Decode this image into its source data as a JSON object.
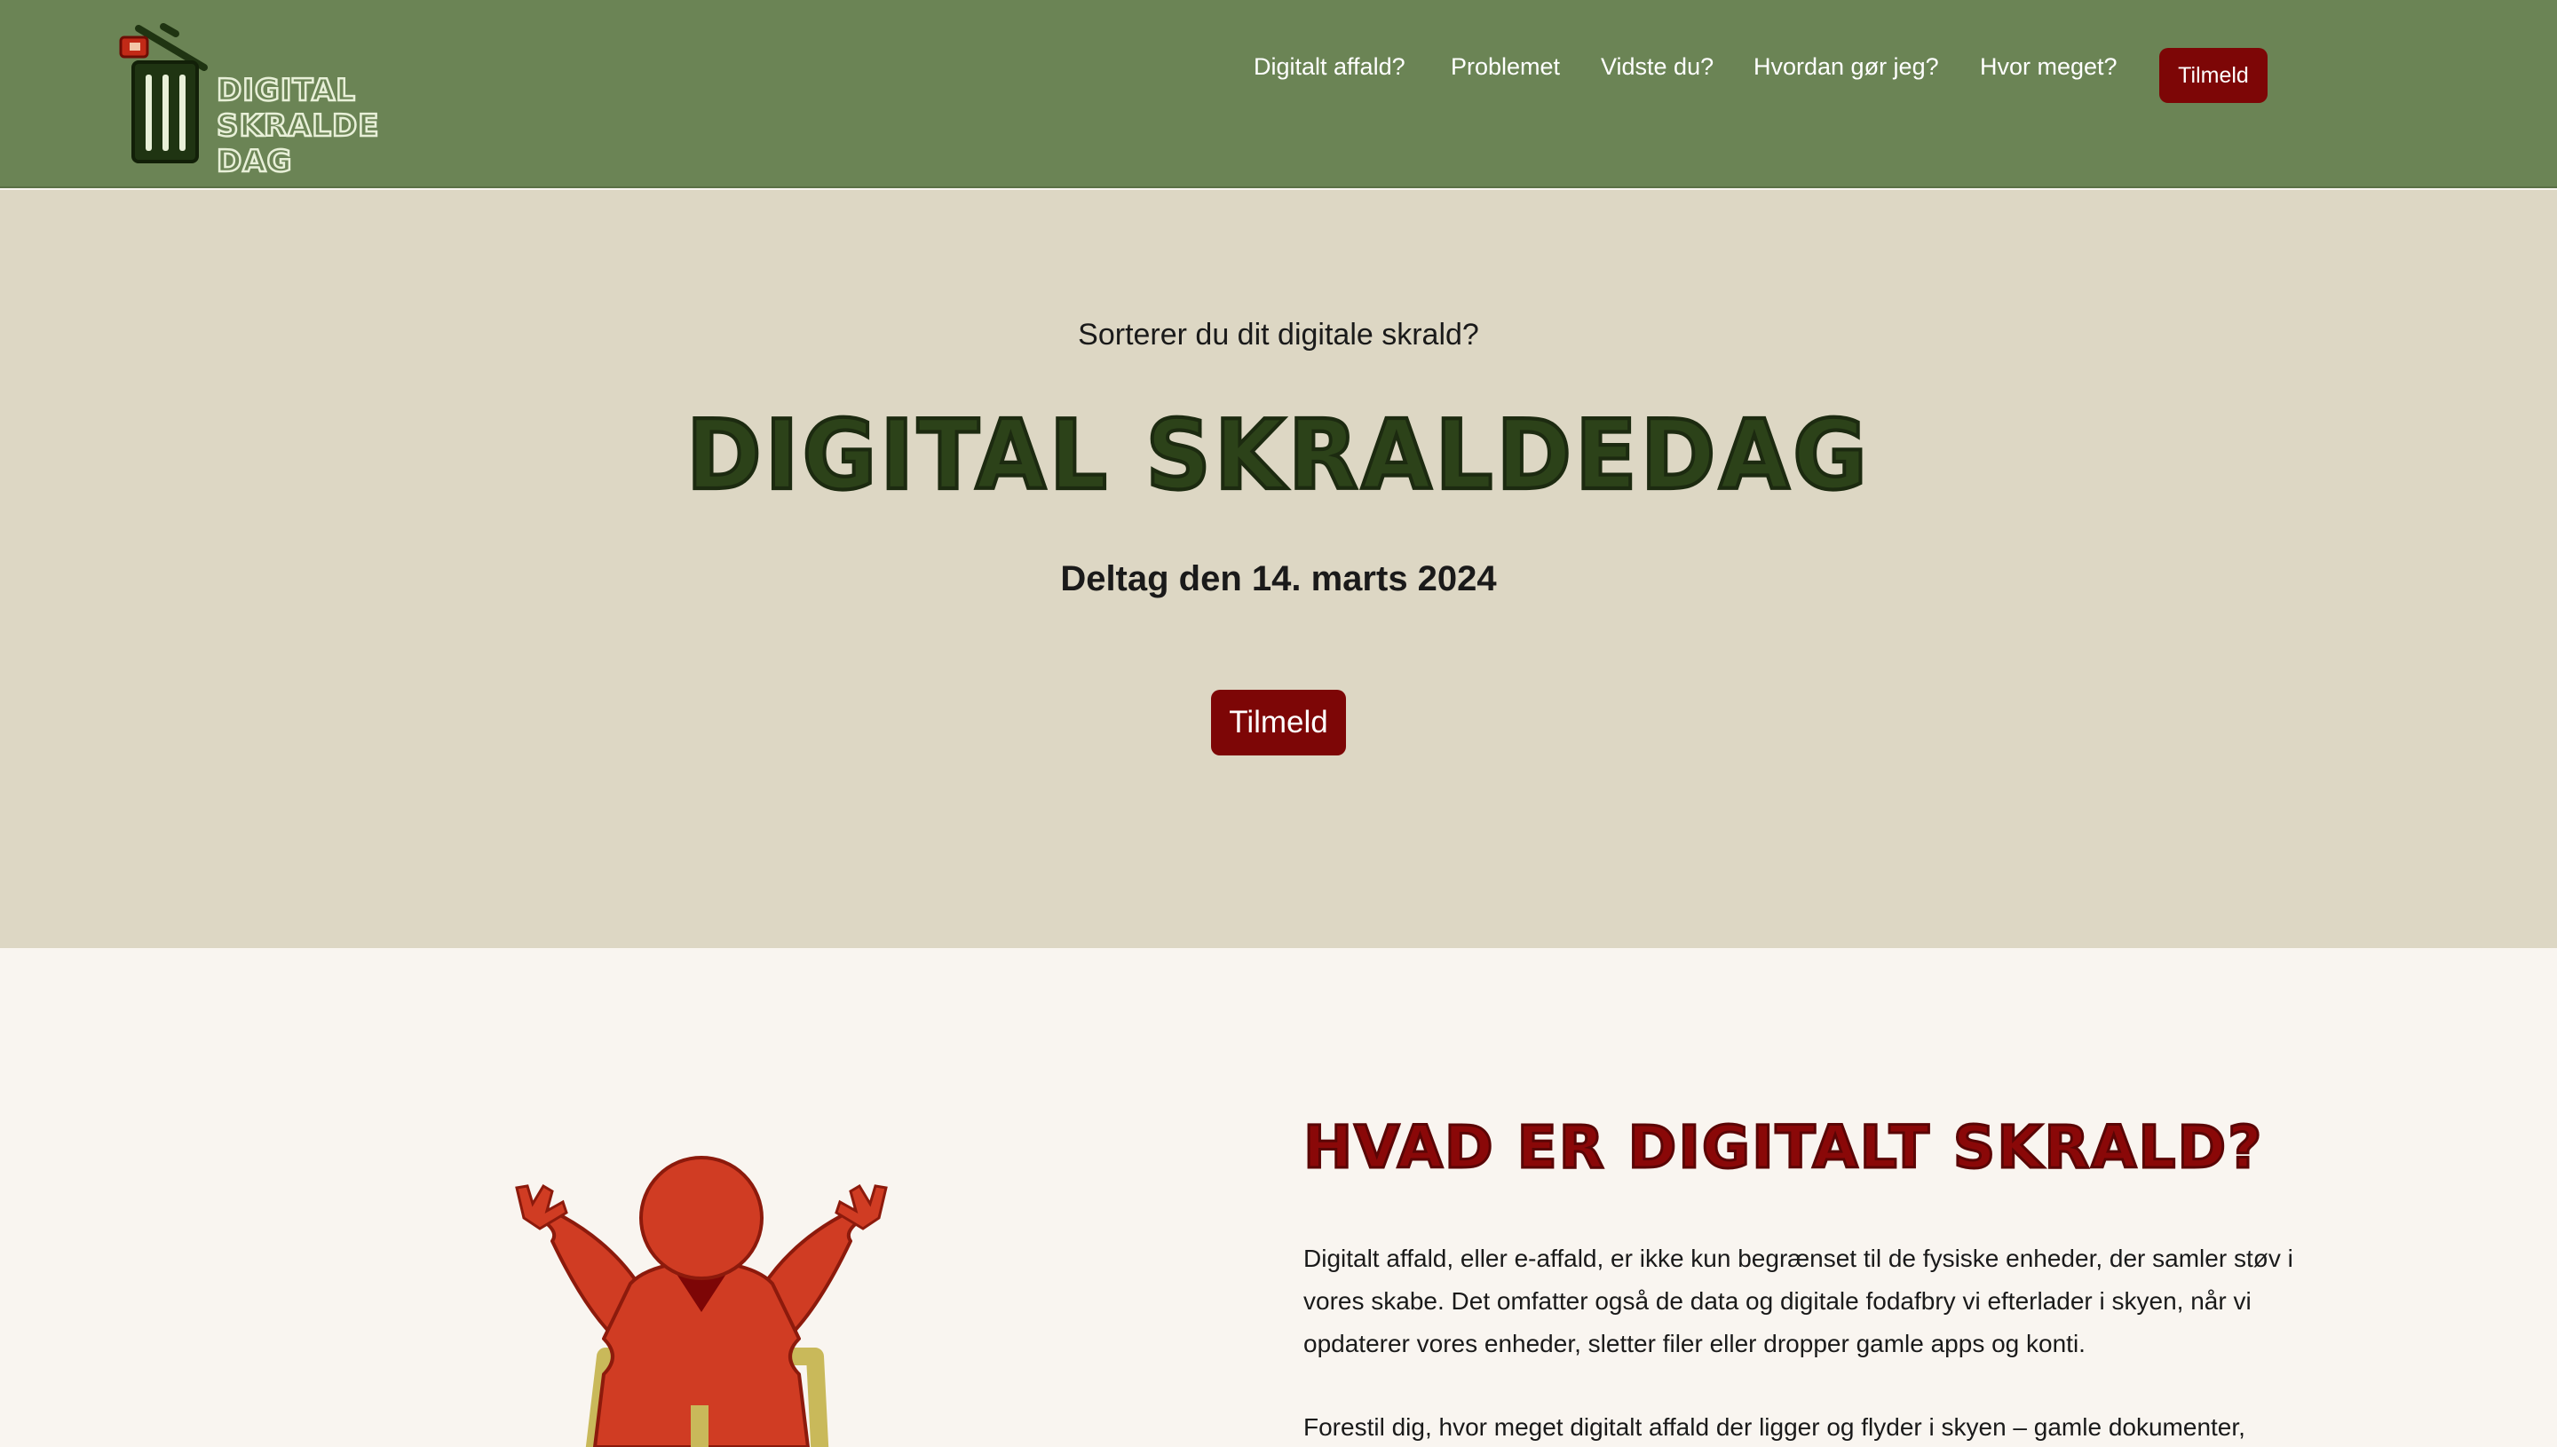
{
  "header": {
    "logo": {
      "alt_label": "DIGITAL SKRALDE DAG",
      "lines": [
        "DIGITAL",
        "SKRALDE",
        "DAG"
      ]
    },
    "nav": [
      {
        "label": "Digitalt affald?"
      },
      {
        "label": "Problemet"
      },
      {
        "label": "Vidste du?"
      },
      {
        "label": "Hvordan gør jeg?"
      },
      {
        "label": "Hvor meget?"
      }
    ],
    "cta_label": "Tilmeld"
  },
  "hero": {
    "subtitle": "Sorterer du dit digitale skrald?",
    "title": "DIGITAL SKRALDEDAG",
    "date_text": "Deltag den 14. marts 2024",
    "button_label": "Tilmeld"
  },
  "section": {
    "title": "HVAD ER DIGITALT SKRALD?",
    "paragraph1": "Digitalt affald, eller e-affald, er ikke kun begrænset til de fysiske enheder, der samler støv i vores skabe. Det omfatter også de data og digitale fodafbry vi efterlader i skyen, når vi opdaterer vores enheder, sletter filer eller dropper gamle apps og konti.",
    "paragraph2": "Forestil dig, hvor meget digitalt affald der ligger og flyder i skyen – gamle dokumenter,"
  },
  "colors": {
    "header_bg": "#6b8455",
    "hero_bg": "#ddd7c4",
    "content_bg": "#f9f5f0",
    "accent_red": "#7d0606",
    "title_green": "#2c4219",
    "figure_red": "#d03c23",
    "chair_yellow": "#c9b95a"
  },
  "icons": {
    "logo": "trash-can-icon",
    "illustration": "shrugging-person-illustration"
  }
}
